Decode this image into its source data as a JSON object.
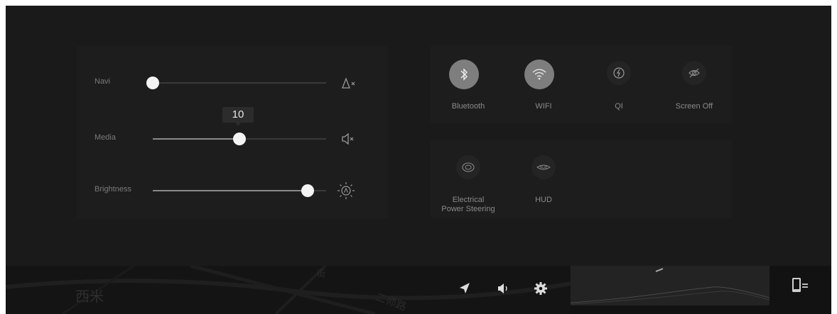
{
  "sliders": [
    {
      "label": "Navi",
      "value_fraction": 0.0,
      "icon": "navi-mute-icon"
    },
    {
      "label": "Media",
      "value_fraction": 0.5,
      "tooltip": "10",
      "icon": "media-mute-icon"
    },
    {
      "label": "Brightness",
      "value_fraction": 0.9,
      "icon": "brightness-auto-icon"
    }
  ],
  "quick_toggles": [
    {
      "label": "Bluetooth",
      "state": "on",
      "icon": "bluetooth-icon"
    },
    {
      "label": "WIFI",
      "state": "on",
      "icon": "wifi-icon"
    },
    {
      "label": "QI",
      "state": "off",
      "icon": "wireless-charging-icon"
    },
    {
      "label": "Screen Off",
      "state": "off",
      "icon": "eye-off-icon"
    }
  ],
  "vehicle_toggles": [
    {
      "label_line1": "Electrical",
      "label_line2": "Power Steering",
      "icon": "steering-icon"
    },
    {
      "label_line1": "HUD",
      "icon": "hud-icon"
    }
  ],
  "bottom_bar": {
    "map_texts": [
      "西米",
      "街",
      "二师路"
    ],
    "buttons": [
      "navigation-icon",
      "volume-icon",
      "settings-icon"
    ],
    "side_button": "phone-projection-icon"
  }
}
